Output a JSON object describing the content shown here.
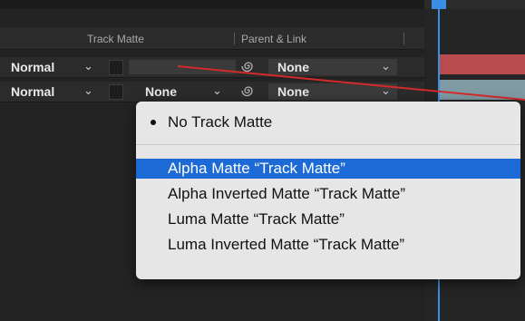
{
  "header": {
    "track_matte_label": "Track Matte",
    "parent_link_label": "Parent & Link"
  },
  "rows": [
    {
      "mode": "Normal",
      "track_matte": "",
      "parent": "None"
    },
    {
      "mode": "Normal",
      "track_matte": "None",
      "parent": "None"
    }
  ],
  "menu": {
    "checked_item": "No Track Matte",
    "items": [
      {
        "label": "Alpha Matte “Track Matte”",
        "selected": true
      },
      {
        "label": "Alpha Inverted Matte “Track Matte”",
        "selected": false
      },
      {
        "label": "Luma Matte “Track Matte”",
        "selected": false
      },
      {
        "label": "Luma Inverted Matte “Track Matte”",
        "selected": false
      }
    ]
  },
  "colors": {
    "accent": "#1b6ad5",
    "playhead": "#3a8ee6",
    "layer_red": "#b94a4e",
    "layer_teal": "#7f9aa3",
    "pickwhip_line": "#d42a2a"
  },
  "icons": {
    "pickwhip": "spiral-pickwhip-icon",
    "dropdown": "chevron-down-icon",
    "checked": "bullet-dot-icon"
  }
}
